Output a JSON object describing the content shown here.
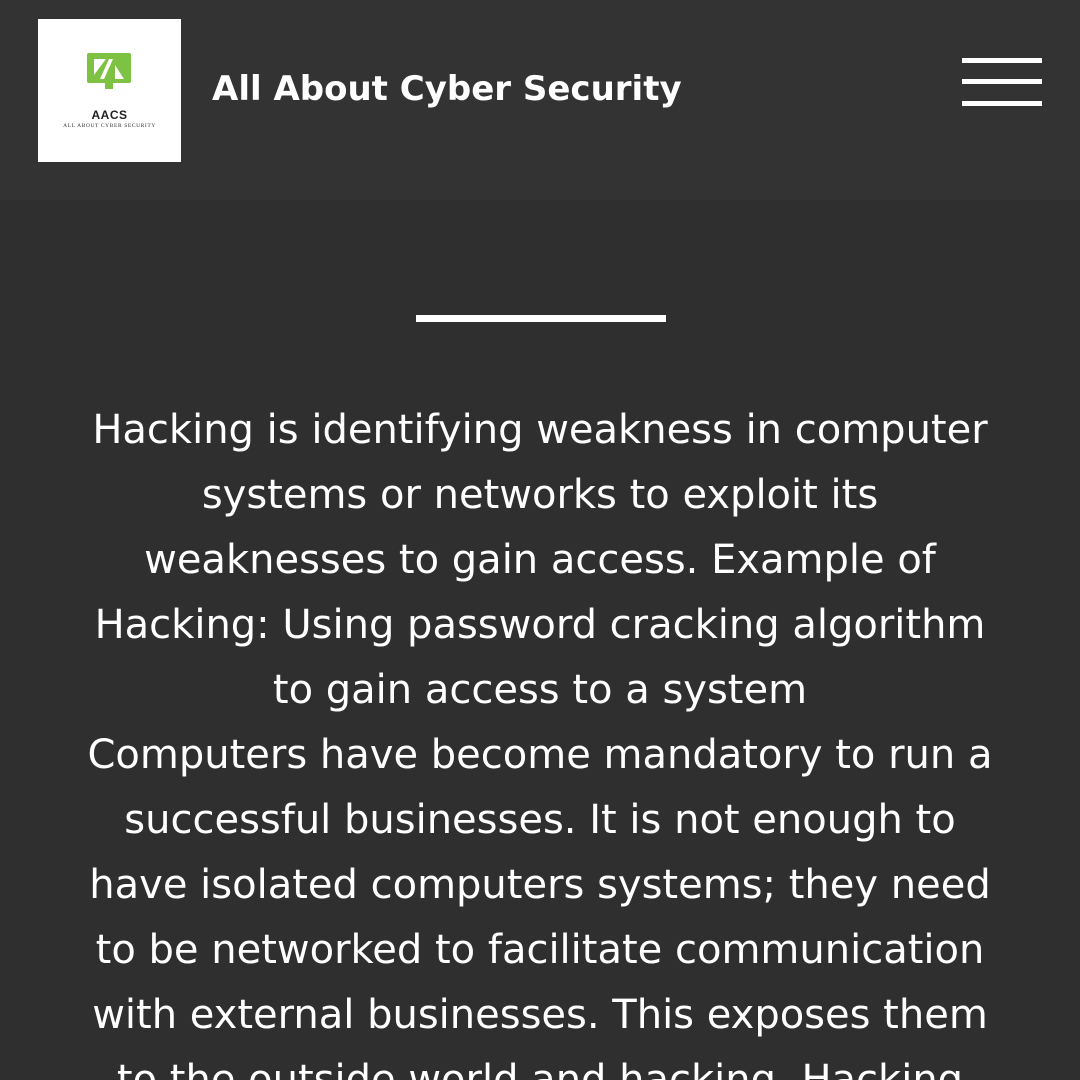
{
  "header": {
    "logo": {
      "icon": "monitor-shield-icon",
      "abbreviation": "AACS",
      "tagline": "ALL ABOUT CYBER SECURITY",
      "color": "#7dc242"
    },
    "site_title": "All About Cyber Security",
    "menu_icon": "hamburger-menu-icon"
  },
  "article": {
    "lines": [
      "Hacking is identifying weakness in computer",
      "systems or networks to exploit its",
      "weaknesses to gain access. Example of",
      "Hacking: Using password cracking algorithm",
      "to gain access to a system",
      "Computers have become mandatory to run a",
      "successful businesses. It is not enough to",
      "have isolated computers systems; they need",
      "to be networked to facilitate communication",
      "with external businesses. This exposes them",
      "to the outside world and hacking. Hacking"
    ]
  },
  "colors": {
    "background": "#2f2f2f",
    "header_background": "#333333",
    "text": "#ffffff",
    "accent": "#7dc242"
  }
}
